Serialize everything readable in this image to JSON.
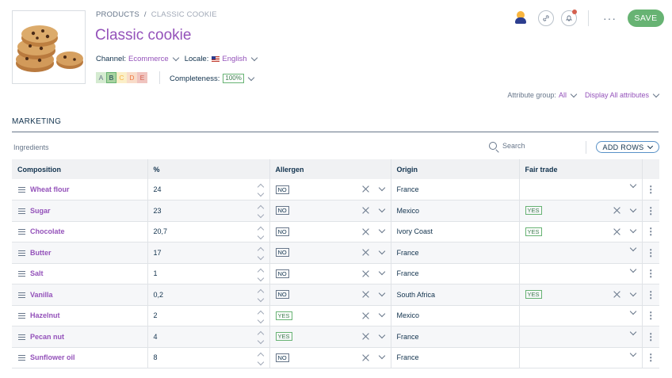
{
  "breadcrumb": [
    "PRODUCTS",
    "/",
    "CLASSIC COOKIE"
  ],
  "title": "Classic cookie",
  "context": {
    "channel_label": "Channel:",
    "channel_value": "Ecommerce",
    "locale_label": "Locale:",
    "locale_value": "English"
  },
  "grades": [
    "A",
    "B",
    "C",
    "D",
    "E"
  ],
  "completeness": {
    "label": "Completeness:",
    "value": "100%"
  },
  "actions": {
    "save_label": "SAVE",
    "more": "···"
  },
  "attribute_bar": {
    "group_label": "Attribute group:",
    "group_value": "All",
    "display_label": "Display All attributes"
  },
  "section": {
    "title": "MARKETING"
  },
  "table_toolbar": {
    "label": "Ingredients",
    "search_placeholder": "Search",
    "add_rows_label": "ADD ROWS"
  },
  "table": {
    "headers": [
      "Composition",
      "%",
      "Allergen",
      "Origin",
      "Fair trade"
    ],
    "rows": [
      {
        "name": "Wheat flour",
        "pct": "24",
        "allergen": "NO",
        "origin": "France",
        "fair": ""
      },
      {
        "name": "Sugar",
        "pct": "23",
        "allergen": "NO",
        "origin": "Mexico",
        "fair": "YES"
      },
      {
        "name": "Chocolate",
        "pct": "20,7",
        "allergen": "NO",
        "origin": "Ivory Coast",
        "fair": "YES"
      },
      {
        "name": "Butter",
        "pct": "17",
        "allergen": "NO",
        "origin": "France",
        "fair": ""
      },
      {
        "name": "Salt",
        "pct": "1",
        "allergen": "NO",
        "origin": "France",
        "fair": ""
      },
      {
        "name": "Vanilla",
        "pct": "0,2",
        "allergen": "NO",
        "origin": "South Africa",
        "fair": "YES"
      },
      {
        "name": "Hazelnut",
        "pct": "2",
        "allergen": "YES",
        "origin": "Mexico",
        "fair": ""
      },
      {
        "name": "Pecan nut",
        "pct": "4",
        "allergen": "YES",
        "origin": "France",
        "fair": ""
      },
      {
        "name": "Sunflower oil",
        "pct": "8",
        "allergen": "NO",
        "origin": "France",
        "fair": ""
      }
    ]
  },
  "colors": {
    "accent": "#9452ba",
    "success": "#67b373",
    "text": "#11324d",
    "muted": "#67768a"
  }
}
